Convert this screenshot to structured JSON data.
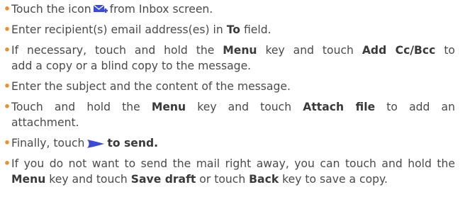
{
  "colors": {
    "bullet": "#f28c28",
    "icon": "#3b4bd9"
  },
  "icons": {
    "compose": "compose-mail-icon",
    "send": "send-arrow-icon"
  },
  "bullet_char": "•",
  "steps": [
    {
      "a": "Touch the icon",
      "b": "from Inbox screen."
    },
    {
      "a": "Enter recipient(s) email address(es) in",
      "b": "To",
      "c": "field."
    },
    {
      "l1a": "If necessary, touch and hold the",
      "l1b": "Menu",
      "l1c": "key and touch",
      "l1d": "Add Cc/Bcc",
      "l1e": "to",
      "l2": "add a copy or a blind copy to the message."
    },
    {
      "a": "Enter the subject and the content of the message."
    },
    {
      "l1a": "Touch and hold the",
      "l1b": "Menu",
      "l1c": "key and touch",
      "l1d": "Attach file",
      "l1e": "to add an",
      "l2": "attachment."
    },
    {
      "a": "Finally, touch",
      "b": "to send."
    },
    {
      "l1": "If you do not want to send the mail right away, you can touch and hold the",
      "l2a": "Menu",
      "l2b": "key and touch",
      "l2c": "Save draft",
      "l2d": "or touch",
      "l2e": "Back",
      "l2f": "key to save a copy."
    }
  ]
}
